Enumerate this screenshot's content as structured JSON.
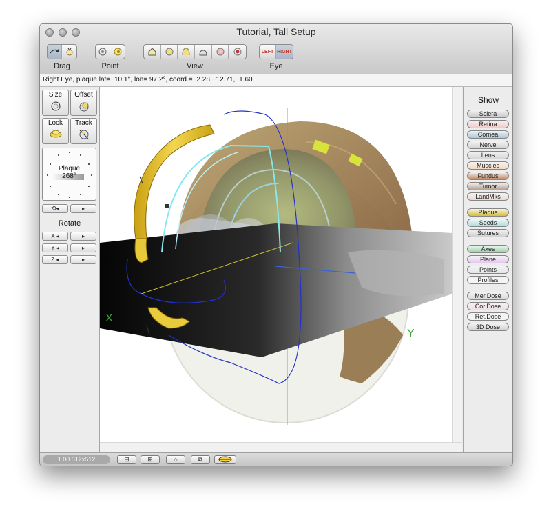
{
  "window": {
    "title": "Tutorial, Tall Setup"
  },
  "toolbar": {
    "drag_label": "Drag",
    "point_label": "Point",
    "view_label": "View",
    "eye_label": "Eye",
    "left_eye": "LEFT",
    "right_eye": "RIGHT",
    "drag_icons": [
      "rotate-drag-icon",
      "pan-hand-icon"
    ],
    "point_icons": [
      "point-eye-icon",
      "point-plaque-icon"
    ],
    "view_icons": [
      "view-home-icon",
      "view-eye-front-icon",
      "view-eye-side-icon",
      "view-eye-flat-icon",
      "view-eye-pink-icon",
      "view-eye-target-icon"
    ]
  },
  "status": {
    "text": "Right Eye, plaque lat=−10.1°, lon= 97.2°, coord.=−2.28,−12.71,−1.60"
  },
  "left_panel": {
    "size_label": "Size",
    "offset_label": "Offset",
    "lock_label": "Lock",
    "track_label": "Track",
    "plaque_label": "Plaque",
    "plaque_angle": "268°",
    "rotate_label": "Rotate",
    "axis_x": "X",
    "axis_y": "Y",
    "axis_z": "Z"
  },
  "show_panel": {
    "title": "Show",
    "items": [
      {
        "label": "Sclera",
        "color": "#c8c8c8"
      },
      {
        "label": "Retina",
        "color": "#f1c9c9"
      },
      {
        "label": "Cornea",
        "color": "#a8c8d6"
      },
      {
        "label": "Nerve",
        "color": "#d2d2d2"
      },
      {
        "label": "Lens",
        "color": "#d6d6d6"
      },
      {
        "label": "Muscles",
        "color": "#f0d9bf"
      },
      {
        "label": "Fundus",
        "color": "#c0855d"
      },
      {
        "label": "Tumor",
        "color": "#b49f93"
      },
      {
        "label": "LandMks",
        "color": "#eed8d0"
      },
      {
        "label": "Plaque",
        "color": "#d8bf3a"
      },
      {
        "label": "Seeds",
        "color": "#a9e0e0"
      },
      {
        "label": "Sutures",
        "color": "#d0d0d0"
      },
      {
        "label": "Axes",
        "color": "#94d4aa"
      },
      {
        "label": "Plane",
        "color": "#e8c8f2"
      },
      {
        "label": "Points",
        "color": "#e6e6e6"
      },
      {
        "label": "Profiles",
        "color": "#f6f6f6"
      },
      {
        "label": "Mer.Dose",
        "color": "#d8d8d8"
      },
      {
        "label": "Cor.Dose",
        "color": "#f0dbe6"
      },
      {
        "label": "Ret.Dose",
        "color": "#f4f4f4"
      },
      {
        "label": "3D Dose",
        "color": "#d0d0d0"
      }
    ]
  },
  "viewport": {
    "axis_label_x": "X",
    "axis_label_y": "Y"
  },
  "bottom": {
    "zoom_text": "1.00 512x512",
    "icons": [
      "zoom-out-icon",
      "zoom-in-icon",
      "home-icon",
      "fit-icon",
      "plaque-icon"
    ]
  }
}
